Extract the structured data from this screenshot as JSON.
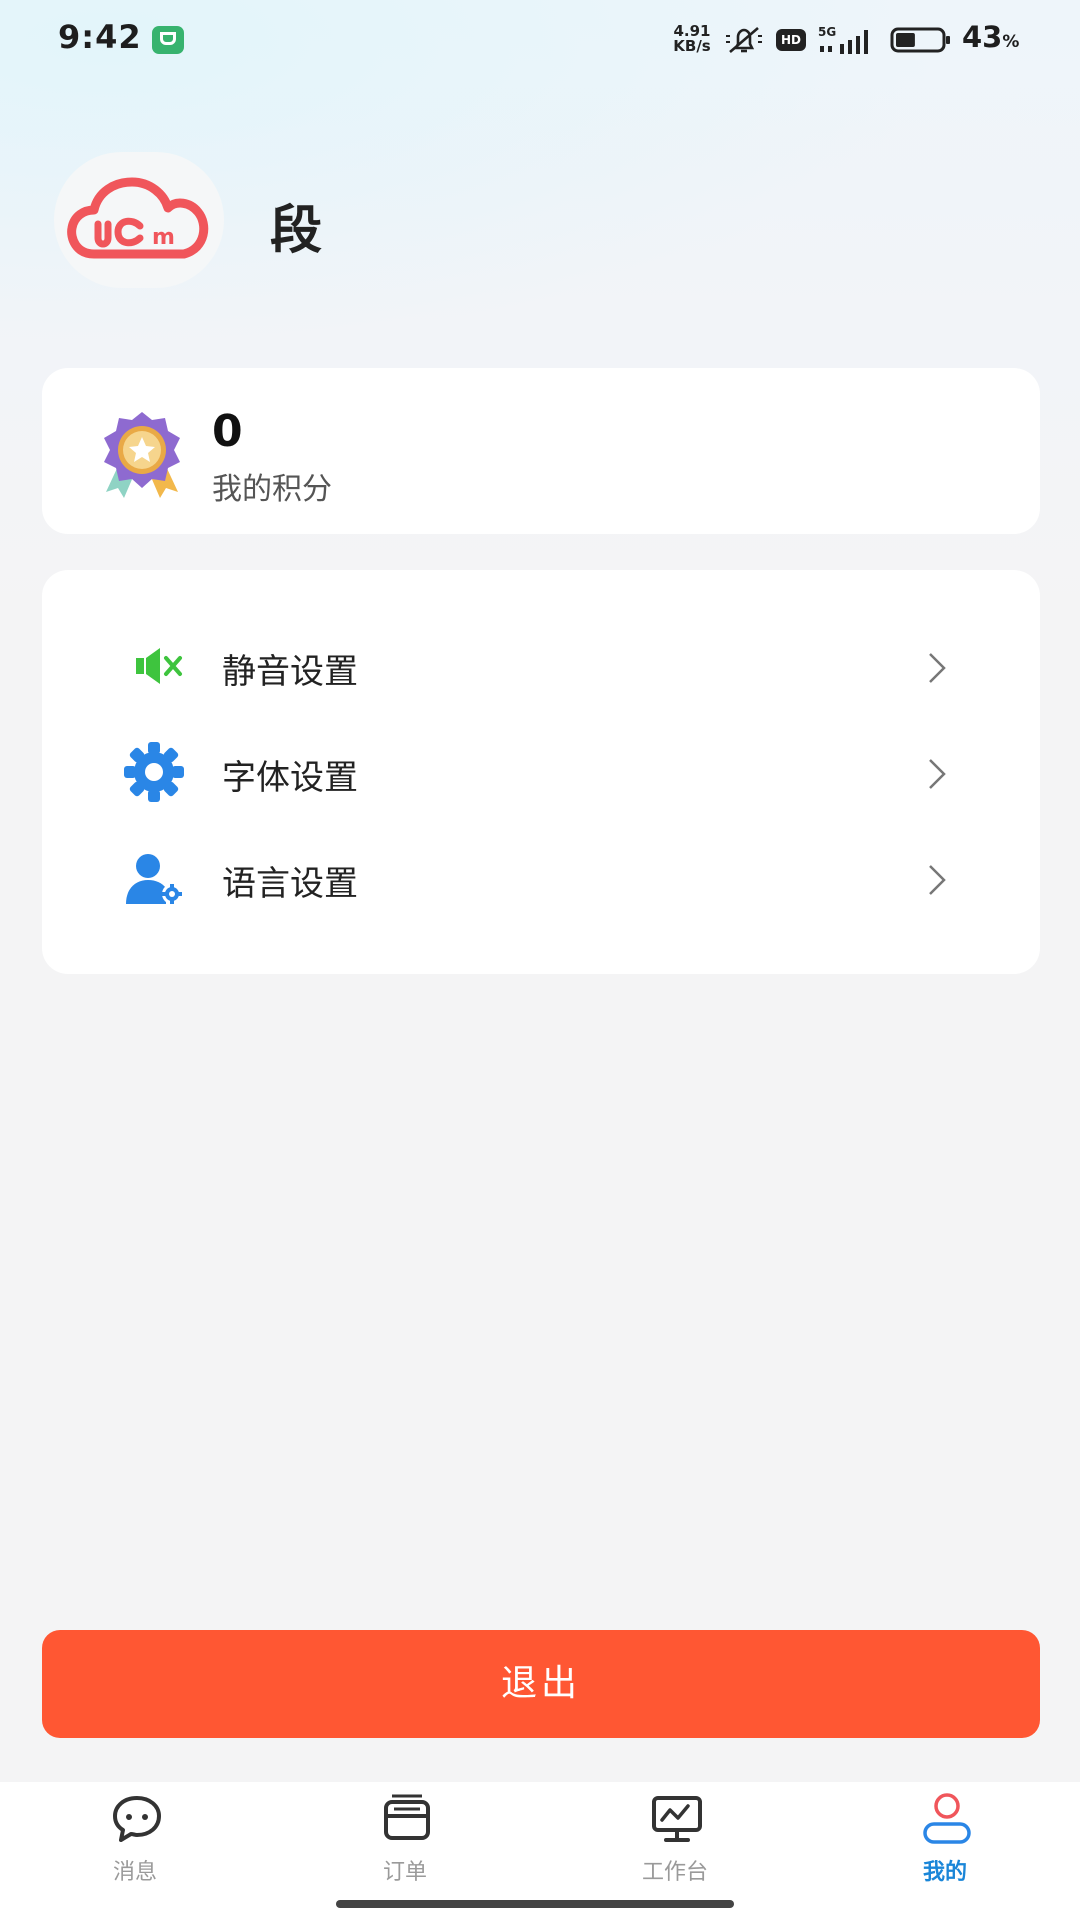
{
  "status_bar": {
    "time": "9:42",
    "net_speed_value": "4.91",
    "net_speed_unit": "KB/s",
    "hd_label": "HD",
    "network_label": "5G",
    "battery_percent": "43",
    "battery_percent_sign": "%",
    "battery_level": 0.43
  },
  "profile": {
    "name": "段",
    "avatar_icon": "cloud-logo-icon",
    "avatar_mark": "m",
    "accent_color": "#f0565b"
  },
  "points": {
    "value": "0",
    "label": "我的积分",
    "icon": "medal-icon"
  },
  "menu": {
    "items": [
      {
        "label": "静音设置",
        "icon": "mute-speaker-icon",
        "color": "#3ec43e"
      },
      {
        "label": "字体设置",
        "icon": "gear-icon",
        "color": "#2a86e6"
      },
      {
        "label": "语言设置",
        "icon": "user-settings-icon",
        "color": "#2a86e6"
      }
    ]
  },
  "logout": {
    "label": "退出",
    "color": "#ff5733"
  },
  "tabs": [
    {
      "label": "消息",
      "icon": "chat-bubble-icon",
      "active": false
    },
    {
      "label": "订单",
      "icon": "order-box-icon",
      "active": false
    },
    {
      "label": "工作台",
      "icon": "monitor-chart-icon",
      "active": false
    },
    {
      "label": "我的",
      "icon": "person-icon",
      "active": true
    }
  ]
}
